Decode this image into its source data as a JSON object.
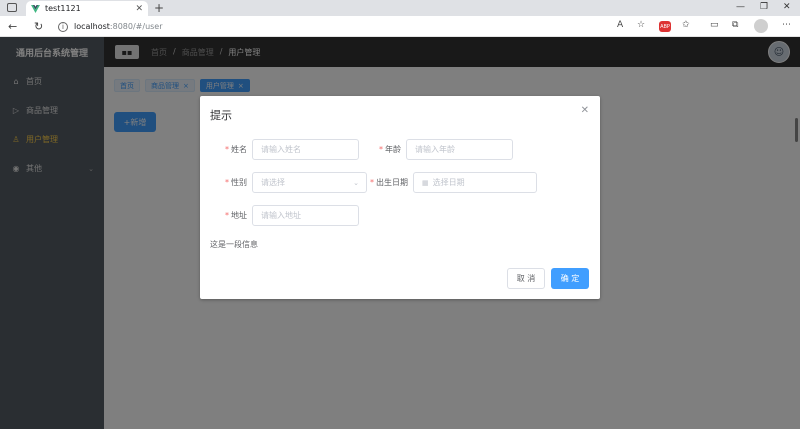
{
  "browser": {
    "tab_title": "test1121",
    "url_host": "localhost",
    "url_rest": ":8080/#/user"
  },
  "sidebar": {
    "brand": "通用后台系统管理",
    "items": [
      {
        "label": "首页",
        "icon": "home-icon"
      },
      {
        "label": "商品管理",
        "icon": "video-icon"
      },
      {
        "label": "用户管理",
        "icon": "user-icon"
      },
      {
        "label": "其他",
        "icon": "location-icon"
      }
    ]
  },
  "header": {
    "breadcrumbs": [
      "首页",
      "商品管理",
      "用户管理"
    ],
    "separator": "/"
  },
  "tags": [
    {
      "label": "首页"
    },
    {
      "label": "商品管理"
    },
    {
      "label": "用户管理"
    }
  ],
  "main": {
    "add_button": "+新增"
  },
  "dialog": {
    "title": "提示",
    "fields": {
      "name": {
        "label": "姓名",
        "placeholder": "请输入姓名"
      },
      "age": {
        "label": "年龄",
        "placeholder": "请输入年龄"
      },
      "gender": {
        "label": "性别",
        "placeholder": "请选择"
      },
      "birth": {
        "label": "出生日期",
        "placeholder": "选择日期"
      },
      "address": {
        "label": "地址",
        "placeholder": "请输入地址"
      }
    },
    "info": "这是一段信息",
    "cancel": "取 消",
    "confirm": "确 定"
  },
  "colors": {
    "primary": "#409eff",
    "sidebar_bg": "#545c64",
    "header_bg": "#333333",
    "active_menu": "#ffd04b"
  }
}
